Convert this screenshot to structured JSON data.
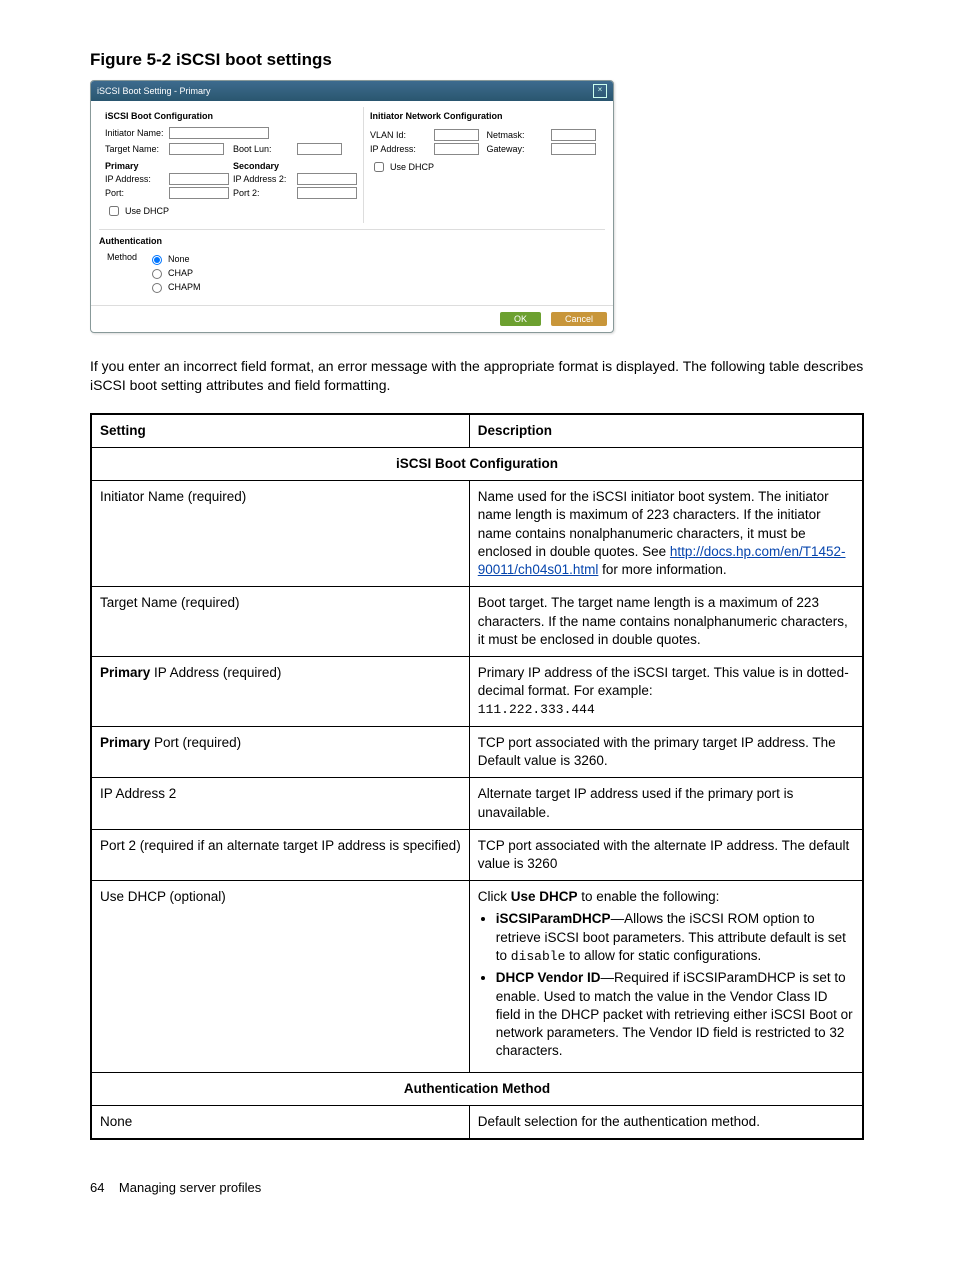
{
  "figure_title": "Figure 5-2 iSCSI boot settings",
  "dialog": {
    "title": "iSCSI Boot Setting - Primary",
    "left_title": "iSCSI Boot Configuration",
    "right_title": "Initiator Network Configuration",
    "labels": {
      "initiator": "Initiator Name:",
      "target": "Target Name:",
      "primary": "Primary",
      "secondary": "Secondary",
      "ip": "IP Address:",
      "ip2": "IP Address 2:",
      "port": "Port:",
      "port2": "Port 2:",
      "bootlun": "Boot Lun:",
      "usedhcp": "Use DHCP",
      "vlan": "VLAN Id:",
      "netmask": "Netmask:",
      "gateway": "Gateway:"
    },
    "auth_title": "Authentication",
    "method_label": "Method",
    "radios": {
      "none": "None",
      "chap": "CHAP",
      "chapm": "CHAPM"
    },
    "ok": "OK",
    "cancel": "Cancel"
  },
  "paragraph": "If you enter an incorrect field format, an error message with the appropriate format is displayed. The following table describes iSCSI boot setting attributes and field formatting.",
  "table": {
    "head_setting": "Setting",
    "head_desc": "Description",
    "group1": "iSCSI Boot Configuration",
    "r1s": "Initiator Name (required)",
    "r1d_a": "Name used for the iSCSI initiator boot system. The initiator name length is maximum of 223 characters. If the initiator name contains nonalphanumeric characters, it must be enclosed in double quotes. See ",
    "r1d_link": "http://docs.hp.com/en/T1452-90011/ch04s01.html",
    "r1d_b": " for more information.",
    "r2s": "Target Name (required)",
    "r2d": "Boot target. The target name length is a maximum of 223 characters. If the name contains nonalphanumeric characters, it must be enclosed in double quotes.",
    "r3s_b": "Primary",
    "r3s_t": " IP Address (required)",
    "r3d_a": "Primary IP address of the iSCSI target. This value is in dotted-decimal format. For example: ",
    "r3d_m": "111.222.333.444",
    "r4s_b": "Primary",
    "r4s_t": " Port (required)",
    "r4d": "TCP port associated with the primary target IP address. The Default value is 3260.",
    "r5s": "IP Address 2",
    "r5d": "Alternate target IP address used if the primary port is unavailable.",
    "r6s": "Port 2 (required if an alternate target IP address is specified)",
    "r6d": "TCP port associated with the alternate IP address. The default value is 3260",
    "r7s": "Use DHCP (optional)",
    "r7d_a": "Click ",
    "r7d_b": "Use DHCP",
    "r7d_c": " to enable the following:",
    "r7b1_b": "iSCSIParamDHCP",
    "r7b1_t1": "—Allows the iSCSI ROM option to retrieve iSCSI boot parameters. This attribute default is set to ",
    "r7b1_m": "disable",
    "r7b1_t2": " to allow for static configurations.",
    "r7b2_b": "DHCP Vendor ID",
    "r7b2_t": "—Required if iSCSIParamDHCP is set to enable. Used to match the value in the Vendor Class ID field in the DHCP packet with retrieving either iSCSI Boot or network parameters. The Vendor ID field is restricted to 32 characters.",
    "group2": "Authentication Method",
    "r8s": "None",
    "r8d": "Default selection for the authentication method."
  },
  "footer": {
    "page": "64",
    "section": "Managing server profiles"
  }
}
